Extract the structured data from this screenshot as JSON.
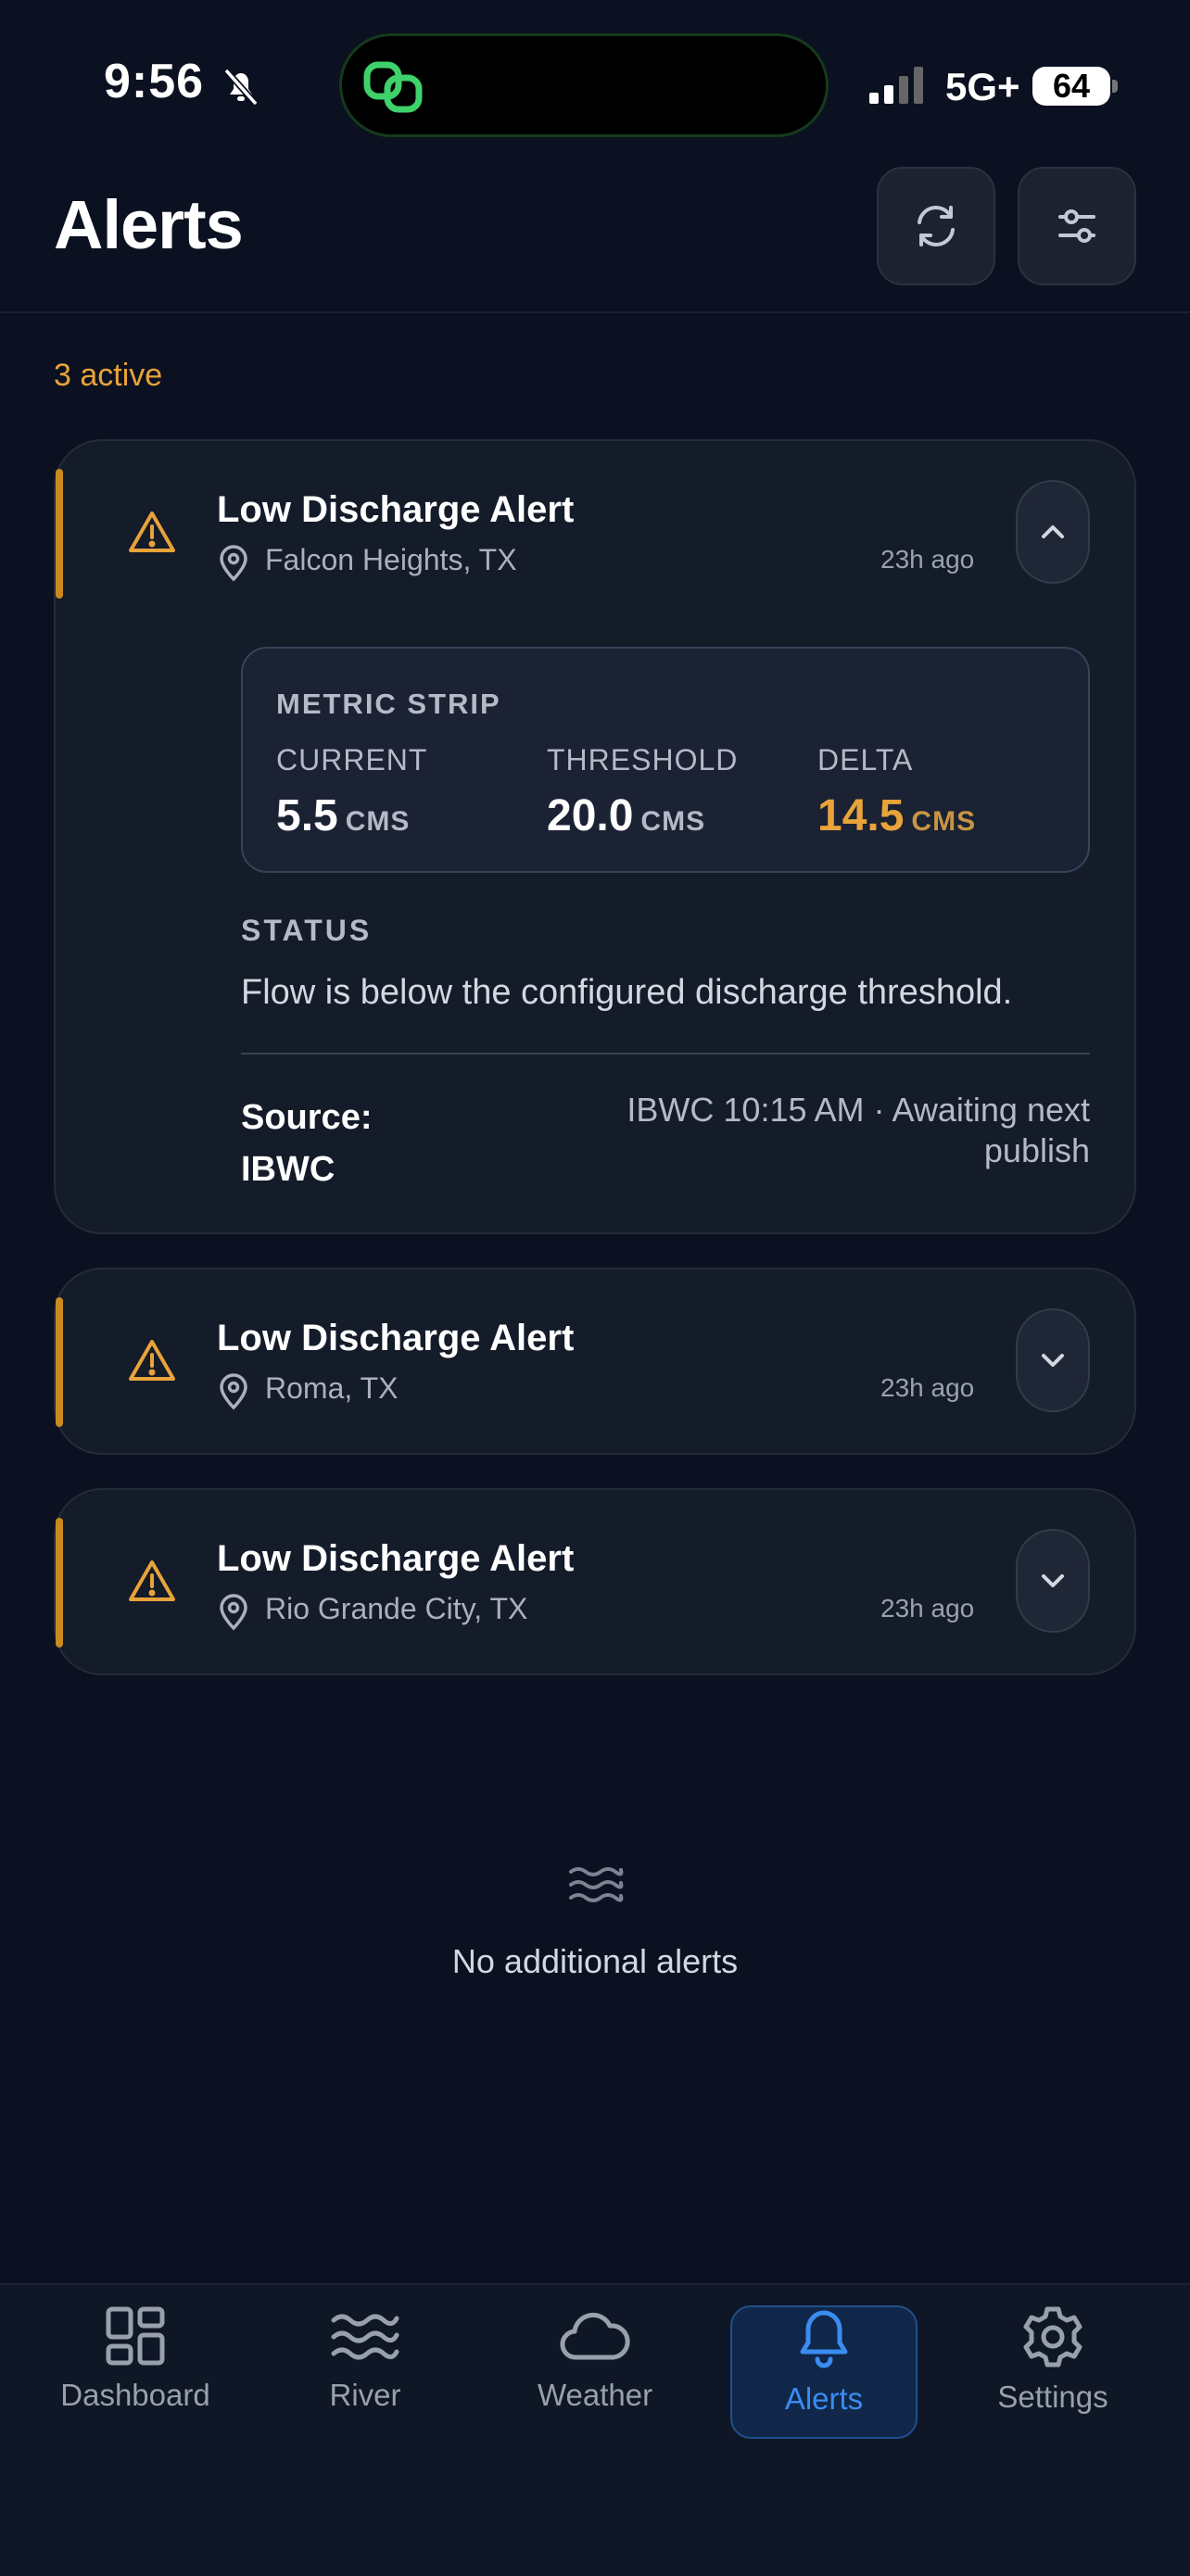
{
  "status_bar": {
    "time": "9:56",
    "network": "5G+",
    "battery": "64"
  },
  "header": {
    "title": "Alerts"
  },
  "summary": {
    "active_count": "3 active"
  },
  "alerts": [
    {
      "title": "Low Discharge Alert",
      "location": "Falcon Heights, TX",
      "ago": "23h ago",
      "expanded": true,
      "metrics": {
        "heading": "METRIC STRIP",
        "current": {
          "label": "CURRENT",
          "value": "5.5",
          "unit": "CMS"
        },
        "threshold": {
          "label": "THRESHOLD",
          "value": "20.0",
          "unit": "CMS"
        },
        "delta": {
          "label": "DELTA",
          "value": "14.5",
          "unit": "CMS"
        }
      },
      "status_label": "STATUS",
      "status_text": "Flow is below the configured discharge threshold.",
      "source_label": "Source:",
      "source_value": "IBWC",
      "source_detail": "IBWC 10:15 AM · Awaiting next publish"
    },
    {
      "title": "Low Discharge Alert",
      "location": "Roma, TX",
      "ago": "23h ago",
      "expanded": false
    },
    {
      "title": "Low Discharge Alert",
      "location": "Rio Grande City, TX",
      "ago": "23h ago",
      "expanded": false
    }
  ],
  "empty_state": {
    "text": "No additional alerts"
  },
  "nav": {
    "items": [
      {
        "label": "Dashboard",
        "icon": "dashboard-icon"
      },
      {
        "label": "River",
        "icon": "waves-icon"
      },
      {
        "label": "Weather",
        "icon": "cloud-icon"
      },
      {
        "label": "Alerts",
        "icon": "bell-icon",
        "active": true
      },
      {
        "label": "Settings",
        "icon": "gear-icon"
      }
    ]
  },
  "colors": {
    "background": "#0b1120",
    "warning": "#e8a33a",
    "accent_active": "#3b8cf0",
    "card": "#141b29"
  }
}
